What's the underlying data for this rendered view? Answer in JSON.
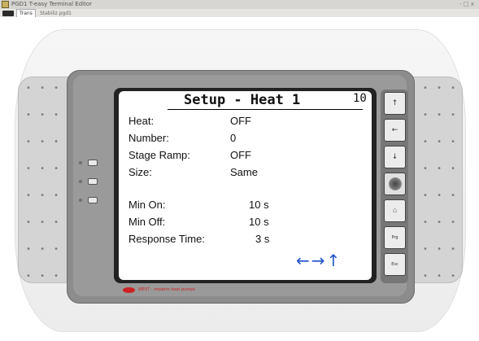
{
  "window": {
    "title": "PGD1 T-easy Terminal Editor",
    "controls": "- □ x"
  },
  "tabs": [
    {
      "label": "Trans",
      "active": true
    },
    {
      "label": "Stabiliz pgd1",
      "active": false
    }
  ],
  "screen": {
    "title": "Setup - Heat 1",
    "page_number": "10",
    "rows": [
      {
        "label": "Heat:",
        "value": "OFF"
      },
      {
        "label": "Number:",
        "value": "0"
      },
      {
        "label": "Stage Ramp:",
        "value": "OFF"
      },
      {
        "label": "Size:",
        "value": "Same"
      },
      {
        "label": "Min On:",
        "value": "10 s"
      },
      {
        "label": "Min Off:",
        "value": "10 s"
      },
      {
        "label": "Response Time:",
        "value": "3 s"
      }
    ],
    "nav_arrows": "←→↑"
  },
  "keypad": {
    "keys": [
      {
        "glyph": "↑"
      },
      {
        "glyph": "←"
      },
      {
        "glyph": "↓"
      },
      {
        "glyph": ""
      },
      {
        "glyph": "⌂"
      },
      {
        "glyph": "Prg"
      },
      {
        "glyph": "Esc"
      }
    ]
  },
  "side_dots": "• • •",
  "brand": {
    "text": "WEST - modern heat pumps"
  }
}
